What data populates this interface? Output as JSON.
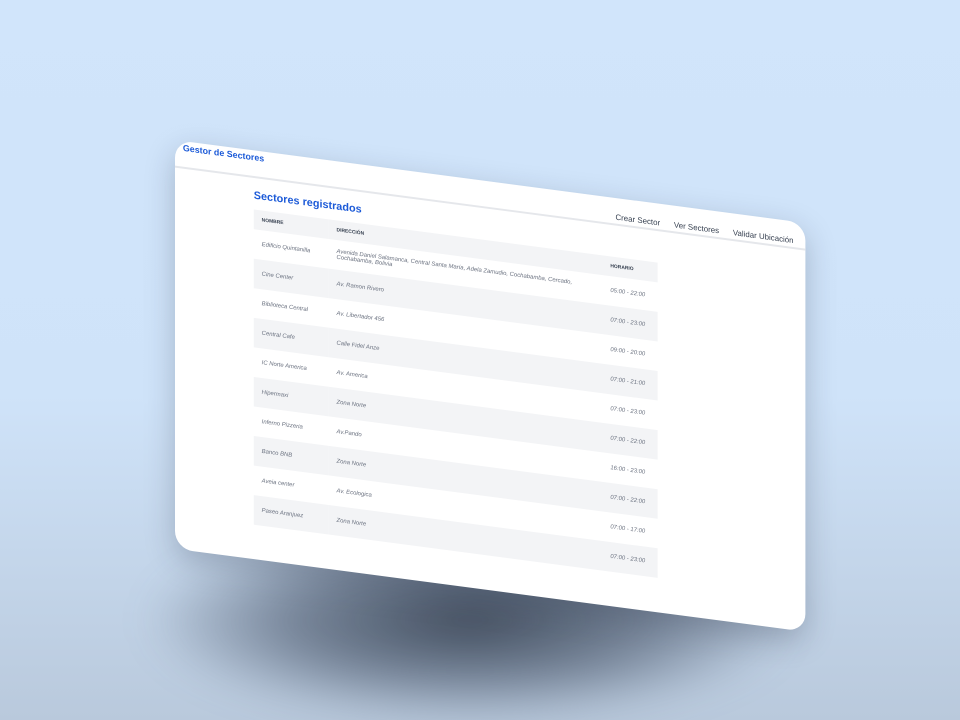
{
  "navbar": {
    "brand": "Gestor de Sectores",
    "links": [
      "Crear Sector",
      "Ver Sectores",
      "Validar Ubicación"
    ]
  },
  "main": {
    "title": "Sectores registrados",
    "table": {
      "headers": [
        "NOMBRE",
        "DIRECCIÓN",
        "HORARIO"
      ],
      "rows": [
        [
          "Edificio Quintanilla",
          "Avenida Daniel Salamanca, Central Santa María, Adela Zamudio, Cochabamba, Cercado, Cochabamba, Bolivia",
          "05:00 - 22:00"
        ],
        [
          "Cine Center",
          "Av. Ramon Rivero",
          "07:00 - 23:00"
        ],
        [
          "Biblioteca Central",
          "Av. Libertador 456",
          "09:00 - 20:00"
        ],
        [
          "Central Cafe",
          "Calle Fidel Anze",
          "07:00 - 21:00"
        ],
        [
          "IC Norte America",
          "Av. America",
          "07:00 - 23:00"
        ],
        [
          "Hipermaxi",
          "Zona Norte",
          "07:00 - 22:00"
        ],
        [
          "Inferno Pizzeria",
          "Av.Pando",
          "16:00 - 23:00"
        ],
        [
          "Banco BNB",
          "Zona Norte",
          "07:00 - 22:00"
        ],
        [
          "Aveia center",
          "Av. Ecologica",
          "07:00 - 17:00"
        ],
        [
          "Paseo Aranjuez",
          "Zona Norte",
          "07:00 - 23:00"
        ]
      ]
    }
  }
}
